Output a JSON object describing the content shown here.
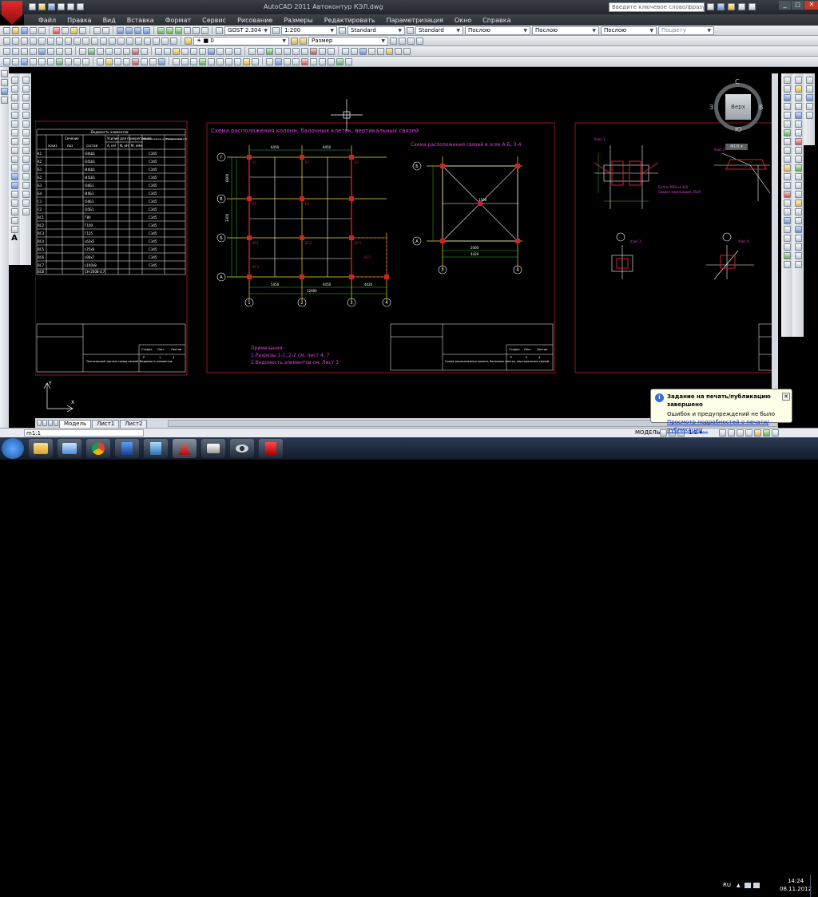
{
  "app": {
    "title": "AutoCAD 2011   Автоконтур КЭЛ.dwg",
    "search_placeholder": "Введите ключевое слово/фразу"
  },
  "menu": [
    "Файл",
    "Правка",
    "Вид",
    "Вставка",
    "Формат",
    "Сервис",
    "Рисование",
    "Размеры",
    "Редактировать",
    "Параметризация",
    "Окно",
    "Справка"
  ],
  "toolbar_props": {
    "text_style": "GOST 2.304",
    "scale": "1:200",
    "table_style": "Standard",
    "dim_style": "Standard",
    "color": "Послою",
    "linetype": "Послою",
    "lineweight": "Послою",
    "plotstyle": "Поцвету",
    "dim_layer": "Размер"
  },
  "viewcube": {
    "top_label": "Верх",
    "north": "С",
    "west": "З",
    "east": "В",
    "south": "Ю",
    "wcs": "МСК"
  },
  "drawing": {
    "sheet1_table_title": "Ведомость элементов",
    "sheet1_headers": [
      "Сечение",
      "Усилие для прикрепления",
      "Наименование или марка металла",
      "Примечание"
    ],
    "sheet1_subheaders": [
      "эскиз",
      "поз",
      "состав",
      "A, кН",
      "N, кН",
      "M, кНм"
    ],
    "sheet1_marks": [
      "K1",
      "K2",
      "Б1",
      "Б2",
      "Б3",
      "Б4",
      "C1",
      "C2",
      "ВС1",
      "ВС2",
      "ВС3",
      "ВС4",
      "ВС5",
      "ВС6",
      "ВС7",
      "ВС8",
      "ВС9"
    ],
    "sheet1_sections": [
      "I30Ш1",
      "I35Ш1",
      "I40Ш1",
      "I45Ш1",
      "I30Б1",
      "I40Б1",
      "I50Б1",
      "I35Б1",
      "Г80",
      "Г100",
      "Г125",
      "L63x5",
      "L75x6",
      "L90x7",
      "L100x8",
      "Гн140x4",
      "СН-2008-3,7"
    ],
    "sheet1_steel": "С345",
    "plan_title": "Схема расположения колонн, балочных клеток, вертикальных связей",
    "section_title": "Схема расположения связей в осях А-Б, 3-4",
    "axes_letters": [
      "Г",
      "В",
      "Б",
      "А"
    ],
    "axes_numbers": [
      "1",
      "2",
      "3",
      "4"
    ],
    "dims": [
      "6450",
      "6450",
      "5450",
      "12900",
      "2000",
      "4420",
      "1500",
      "6600",
      "3300",
      "4200",
      "6900"
    ],
    "plan_marks": [
      "K1",
      "K2",
      "Б1",
      "Б2",
      "Б3",
      "Б4",
      "ВС1",
      "ВС2",
      "ВС3",
      "ВС4",
      "ВС5",
      "ВС6",
      "ВС7",
      "ВС8"
    ],
    "notes_title": "Примечания:",
    "notes": [
      "1.Разрезы 1-1, 2-2 см. лист 4, 7",
      "2.Ведомость элементов см. Лист 3"
    ],
    "stamp1_text": "Технический чертеж схемы связей. Ведомость элементов",
    "stamp2_text": "Схема расположения колонн, балочных клеток, вертикальных связей",
    "stamp_headers": [
      "Стадия",
      "Лист",
      "Листов"
    ],
    "stamp_values": [
      "Р",
      "1",
      "4"
    ],
    "stamp_values2": [
      "Р",
      "2",
      "4"
    ],
    "detail_labels": [
      "Узел 1",
      "Узел 2",
      "Узел 3",
      "Узел 4"
    ],
    "detail_notes": [
      "Болты M20 кл.8.8",
      "Сварка электродом Э50А"
    ],
    "ucs_x": "X",
    "ucs_y": "Y"
  },
  "layout_tabs": [
    "Модель",
    "Лист1",
    "Лист2"
  ],
  "cmdline": {
    "text": "m1:1"
  },
  "status": {
    "mode": "МОДЕЛЬ",
    "scale": "1:1"
  },
  "balloon": {
    "title": "Задание на печать/публикацию завершено",
    "line1": "Ошибок и предупреждений не было",
    "link": "Просмотр подробностей о печати/публикации..."
  },
  "tray": {
    "lang": "RU",
    "time": "14:24",
    "date": "08.11.2012"
  },
  "colors": {
    "drawing_red": "#d0202a",
    "drawing_magenta": "#e040e0",
    "drawing_yellow": "#f0e020",
    "drawing_white": "#ffffff",
    "drawing_cyan": "#40e0e0",
    "drawing_green": "#30c030"
  }
}
